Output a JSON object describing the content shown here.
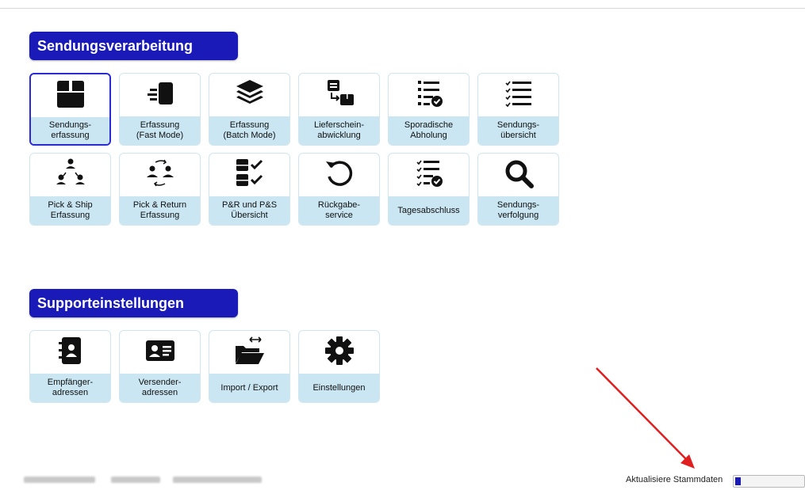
{
  "sections": {
    "processing": {
      "title": "Sendungsverarbeitung",
      "tiles": [
        {
          "label": "Sendungs-\nerfassung",
          "icon": "box-icon"
        },
        {
          "label": "Erfassung\n(Fast Mode)",
          "icon": "fast-box-icon"
        },
        {
          "label": "Erfassung\n(Batch Mode)",
          "icon": "layers-icon"
        },
        {
          "label": "Lieferschein-\nabwicklung",
          "icon": "delivery-note-icon"
        },
        {
          "label": "Sporadische\nAbholung",
          "icon": "list-check-icon"
        },
        {
          "label": "Sendungs-\nübersicht",
          "icon": "checklist-icon"
        },
        {
          "label": "Pick & Ship\nErfassung",
          "icon": "people-network-icon"
        },
        {
          "label": "Pick & Return\nErfassung",
          "icon": "people-exchange-icon"
        },
        {
          "label": "P&R und P&S\nÜbersicht",
          "icon": "boxes-check-icon"
        },
        {
          "label": "Rückgabe-\nservice",
          "icon": "return-icon"
        },
        {
          "label": "Tagesabschluss",
          "icon": "day-close-icon"
        },
        {
          "label": "Sendungs-\nverfolgung",
          "icon": "magnifier-icon"
        }
      ]
    },
    "support": {
      "title": "Supporteinstellungen",
      "tiles": [
        {
          "label": "Empfänger-\nadressen",
          "icon": "address-book-icon"
        },
        {
          "label": "Versender-\nadressen",
          "icon": "id-card-icon"
        },
        {
          "label": "Import / Export",
          "icon": "folder-transfer-icon"
        },
        {
          "label": "Einstellungen",
          "icon": "gear-icon"
        }
      ]
    }
  },
  "status": {
    "label": "Aktualisiere Stammdaten",
    "progress_fraction": 0.08
  },
  "colors": {
    "header": "#1a1ab8",
    "tile_label_bg": "#c9e6f2",
    "annotation_arrow": "#e02020"
  }
}
